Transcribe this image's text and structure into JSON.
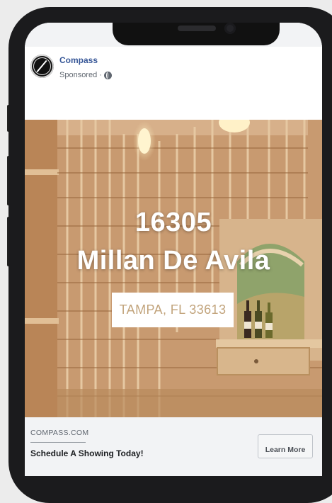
{
  "post": {
    "page_name": "Compass",
    "sponsored_label": "Sponsored",
    "separator": "·",
    "privacy_icon": "globe-icon"
  },
  "ad": {
    "title_line1": "16305",
    "title_line2": "Millan De Avila",
    "location": "TAMPA, FL 33613"
  },
  "footer": {
    "domain": "COMPASS.COM",
    "headline": "Schedule A Showing Today!",
    "cta_label": "Learn More"
  },
  "colors": {
    "page_name": "#385898",
    "location_text": "#c2a47c",
    "wood": "#c9a07a"
  }
}
